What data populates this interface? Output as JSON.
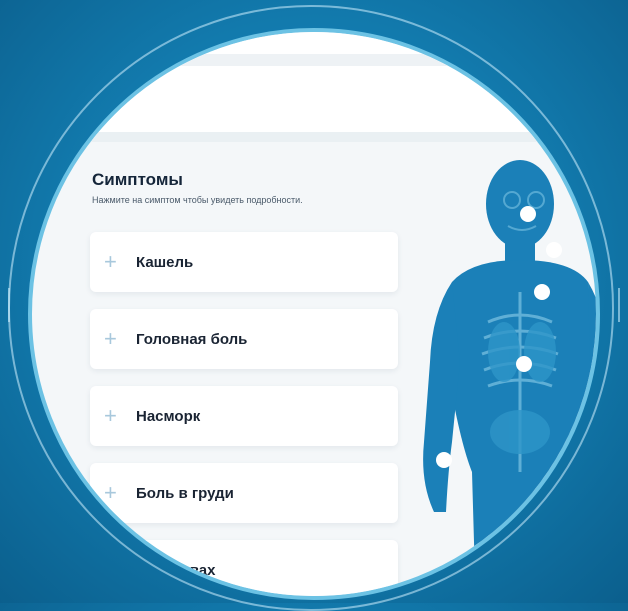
{
  "symptoms": {
    "title": "Симптомы",
    "subtitle": "Нажмите на симптом чтобы увидеть подробности.",
    "items": [
      {
        "label": "Кашель"
      },
      {
        "label": "Головная боль"
      },
      {
        "label": "Насморк"
      },
      {
        "label": "Боль в груди"
      },
      {
        "label": "в суставах"
      }
    ]
  },
  "icons": {
    "expand": "plus-icon"
  },
  "colors": {
    "background": "#127aad",
    "ring": "#6cc2e4",
    "body_figure": "#1b80b8",
    "card_background": "#ffffff",
    "text_dark": "#1a2433"
  }
}
